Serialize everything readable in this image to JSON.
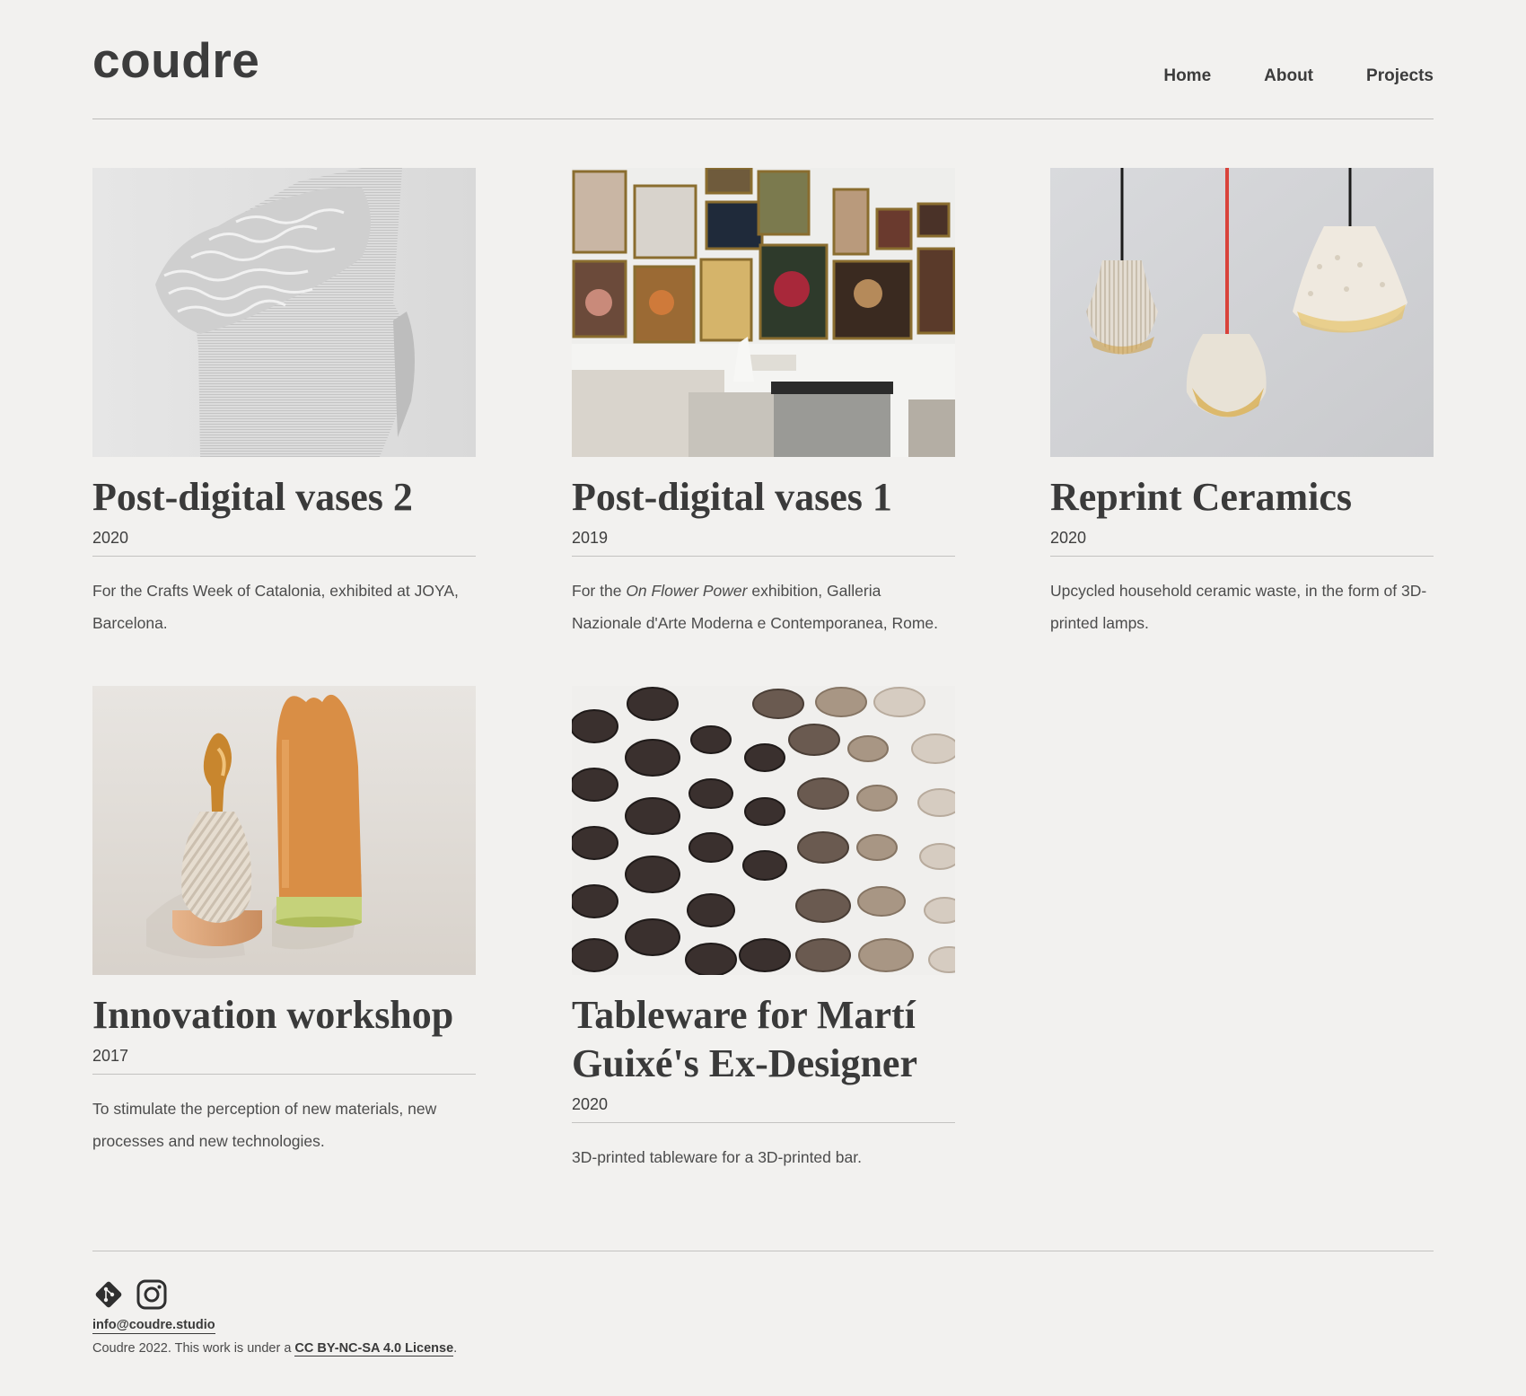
{
  "site": {
    "logo": "coudre"
  },
  "nav": {
    "home": "Home",
    "about": "About",
    "projects": "Projects"
  },
  "projects": [
    {
      "title": "Post-digital vases 2",
      "year": "2020",
      "desc": "For the Crafts Week of Catalonia, exhibited at JOYA, Barcelona."
    },
    {
      "title": "Post-digital vases 1",
      "year": "2019",
      "desc_pre": "For the ",
      "desc_em": "On Flower Power",
      "desc_post": " exhibition, Galleria Nazionale d'Arte Moderna e Contemporanea, Rome."
    },
    {
      "title": "Reprint Ceramics",
      "year": "2020",
      "desc": "Upcycled household ceramic waste, in the form of 3D-printed lamps."
    },
    {
      "title": "Innovation workshop",
      "year": "2017",
      "desc": "To stimulate the perception of new materials, new processes and new technologies."
    },
    {
      "title": "Tableware for Martí Guixé's Ex-Designer",
      "year": "2020",
      "desc": "3D-printed tableware for a 3D-printed bar."
    }
  ],
  "footer": {
    "email": "info@coudre.studio",
    "license_prefix": "Coudre 2022. This work is under a ",
    "license_link": "CC BY-NC-SA 4.0 License",
    "license_suffix": ".",
    "icons": [
      "git-icon",
      "instagram-icon"
    ]
  },
  "colors": {
    "background": "#f2f1ef",
    "text": "#3a3a3a",
    "divider": "#c3c2c0"
  }
}
